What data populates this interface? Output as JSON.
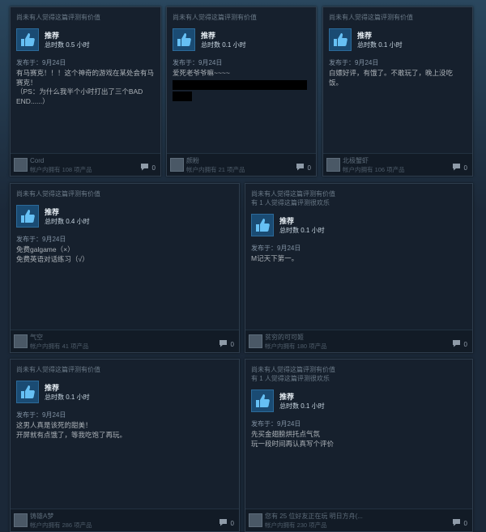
{
  "reviews": [
    {
      "helpful_lines": [
        "尚未有人觉得这篇评测有价值"
      ],
      "rec_label": "推荐",
      "hours": "总时数 0.5 小时",
      "date": "发布于：9月24日",
      "body_lines": [
        "有马赛克！！！这个神奇的游戏在某处会有马",
        "赛克！",
        "（PS：为什么我半个小时打出了三个BAD",
        "END......）"
      ],
      "user": "Cord",
      "products": "帐户内拥有 108 项产品",
      "comments": "0"
    },
    {
      "helpful_lines": [
        "尚未有人觉得这篇评测有价值"
      ],
      "rec_label": "推荐",
      "hours": "总时数 0.1 小时",
      "date": "发布于：9月24日",
      "body_lines": [
        "爱死老爷爷嘛~~~~"
      ],
      "user": "颜粉",
      "products": "帐户内拥有 21 项产品",
      "comments": "0"
    },
    {
      "helpful_lines": [
        "尚未有人觉得这篇评测有价值"
      ],
      "rec_label": "推荐",
      "hours": "总时数 0.1 小时",
      "date": "发布于：9月24日",
      "body_lines": [
        "白嫖好评，有饿了。不敢玩了，晚上没吃饭。"
      ],
      "user": "北极蟹虾",
      "products": "帐户内拥有 106 项产品",
      "comments": "0"
    },
    {
      "helpful_lines": [
        "尚未有人觉得这篇评测有价值"
      ],
      "rec_label": "推荐",
      "hours": "总时数 0.4 小时",
      "date": "发布于：9月24日",
      "body_lines": [
        "免费galgame（×）",
        "免费英语对话练习（√）"
      ],
      "user": "气空",
      "products": "帐户内拥有 41 项产品",
      "comments": "0"
    },
    {
      "helpful_lines": [
        "尚未有人觉得这篇评测有价值",
        "有 1 人觉得这篇评测很欢乐"
      ],
      "rec_label": "推荐",
      "hours": "总时数 0.1 小时",
      "date": "发布于：9月24日",
      "body_lines": [
        "M记天下第一。"
      ],
      "user": "贫穷的可可姬",
      "products": "帐户内拥有 180 项产品",
      "comments": "0"
    },
    {
      "helpful_lines": [
        "尚未有人觉得这篇评测有价值"
      ],
      "rec_label": "推荐",
      "hours": "总时数 0.1 小时",
      "date": "发布于：9月24日",
      "body_lines": [
        "这男人真是该死的甜美！",
        "开屏就有点饿了，等我吃饱了再玩。"
      ],
      "user": "铸雄A梦",
      "products": "帐户内拥有 286 项产品",
      "comments": "0"
    },
    {
      "helpful_lines": [
        "尚未有人觉得这篇评测有价值",
        "有 1 人觉得这篇评测很欢乐"
      ],
      "rec_label": "推荐",
      "hours": "总时数 0.1 小时",
      "date": "发布于：9月24日",
      "body_lines": [
        "先买金翅膀烘托点气氛",
        "玩一段时间再认真写个评价"
      ],
      "user": "您有 25 位好友正在玩 明日方舟(...",
      "products": "帐户内拥有 230 项产品",
      "comments": "0"
    }
  ]
}
